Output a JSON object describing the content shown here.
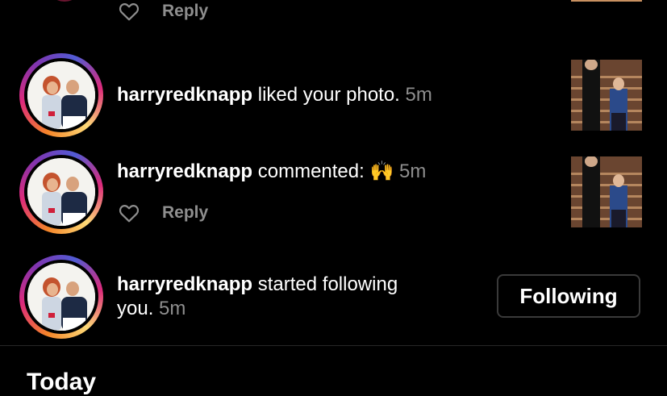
{
  "top_item": {
    "reply_label": "Reply"
  },
  "notifications": [
    {
      "username": "harryredknapp",
      "action": "liked your photo.",
      "time": "5m"
    },
    {
      "username": "harryredknapp",
      "action": "commented:",
      "emoji": "🙌",
      "time": "5m",
      "reply_label": "Reply"
    },
    {
      "username": "harryredknapp",
      "action_line1": "started following",
      "action_line2": "you.",
      "time": "5m",
      "button_label": "Following"
    }
  ],
  "section": {
    "title": "Today"
  },
  "icons": {
    "like": "heart-outline-icon"
  },
  "colors": {
    "background": "#000000",
    "text": "#ffffff",
    "secondary": "#8e8e8e",
    "divider": "#262626"
  }
}
